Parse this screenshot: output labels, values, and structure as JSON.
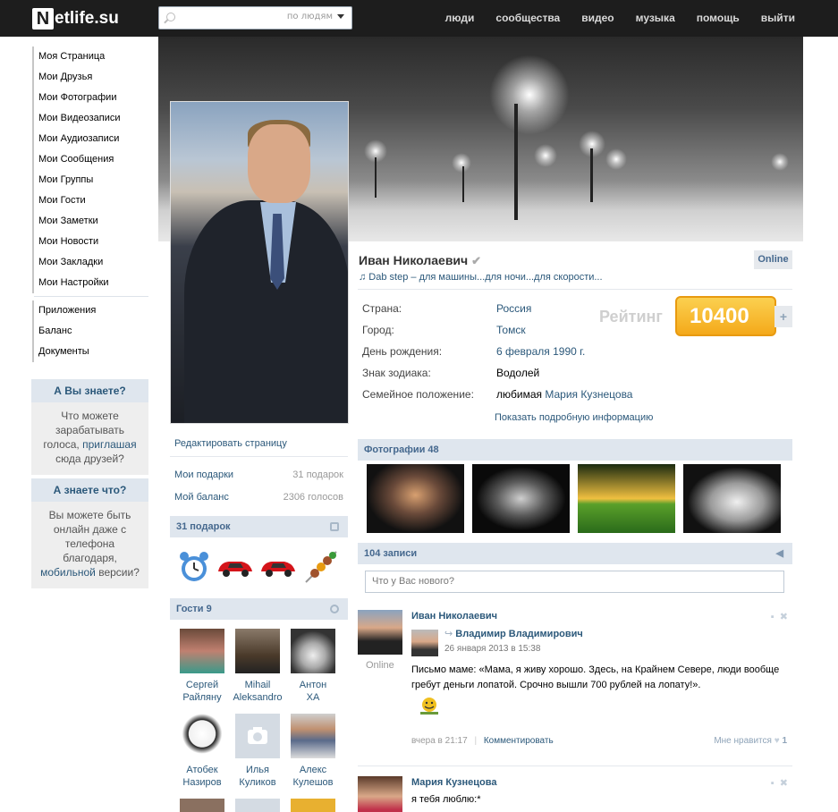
{
  "brand": {
    "logo_letter": "N",
    "logo_text": "etlife.su"
  },
  "search": {
    "placeholder": "",
    "scope": "по людям"
  },
  "nav": [
    "люди",
    "сообщества",
    "видео",
    "музыка",
    "помощь",
    "выйти"
  ],
  "left_menu": {
    "main": [
      "Моя Страница",
      "Мои Друзья",
      "Мои Фотографии",
      "Мои Видеозаписи",
      "Мои Аудиозаписи",
      "Мои Сообщения",
      "Мои Группы",
      "Мои Гости",
      "Мои Заметки",
      "Мои Новости",
      "Мои Закладки",
      "Мои Настройки"
    ],
    "extra": [
      "Приложения",
      "Баланс",
      "Документы"
    ]
  },
  "info_box_1": {
    "title": "А Вы знаете?",
    "text_before": "Что можете зарабатывать голоса, ",
    "link": "приглашая",
    "text_after": " сюда друзей?"
  },
  "info_box_2": {
    "title": "А знаете что?",
    "text_before": "Вы можете быть онлайн даже с телефона благодаря, ",
    "link": "мобильной",
    "text_after": " версии?"
  },
  "profile": {
    "name": "Иван Николаевич",
    "online": "Online",
    "status": "♫ Dab step – для машины...для ночи...для скорости...",
    "info": [
      {
        "label": "Страна:",
        "value": "Россия"
      },
      {
        "label": "Город:",
        "value": "Томск"
      },
      {
        "label": "День рождения:",
        "value": "6 февраля 1990 г."
      },
      {
        "label": "Знак зодиака:",
        "value": "Водолей",
        "plain": true
      },
      {
        "label": "Семейное положение:",
        "value_plain": "любимая ",
        "value": "Мария Кузнецова"
      }
    ],
    "rating_label": "Рейтинг",
    "rating": "10400",
    "rating_plus": "+",
    "more_info": "Показать подробную информацию"
  },
  "left_col": {
    "edit": "Редактировать страницу",
    "gifts_link": "Мои подарки",
    "gifts_count": "31 подарок",
    "balance_link": "Мой баланс",
    "balance_value": "2306 голосов",
    "gifts_head": "31 подарок",
    "guests_head": "Гости 9",
    "guests": [
      {
        "first": "Сергей",
        "last": "Райляну"
      },
      {
        "first": "Mihail",
        "last": "Aleksandro"
      },
      {
        "first": "Антон",
        "last": "ХА"
      },
      {
        "first": "Атобек",
        "last": "Назиров"
      },
      {
        "first": "Илья",
        "last": "Куликов"
      },
      {
        "first": "Алекс",
        "last": "Кулешов"
      }
    ]
  },
  "photos": {
    "head": "Фотографии 48"
  },
  "wall": {
    "head": "104 записи",
    "input_placeholder": "Что у Вас нового?",
    "post1": {
      "author": "Иван Николаевич",
      "online": "Online",
      "repost_author": "Владимир Владимирович",
      "repost_date": "26 января 2013 в 15:38",
      "text": "Письмо маме: «Мама, я живу хорошо. Здесь, на Крайнем Севере, люди вообще гребут деньги лопатой. Срочно вышли 700 рублей на лопату!».",
      "time": "вчера в 21:17",
      "comment": "Комментировать",
      "like_label": "Мне нравится",
      "likes": "1"
    },
    "post2": {
      "author": "Мария Кузнецова",
      "text": "я тебя люблю:*"
    }
  },
  "colors": {
    "topbar": "#1d1d1d",
    "link": "#2b587a",
    "section_head": "#dfe6ee",
    "rating": "#f4a91a"
  }
}
